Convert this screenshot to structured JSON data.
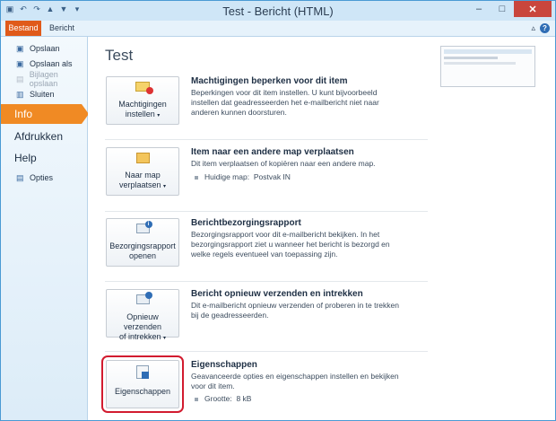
{
  "window": {
    "title": "Test - Bericht (HTML)",
    "qat": {
      "save_icon": "save-icon",
      "undo_icon": "undo-icon",
      "redo_icon": "redo-icon",
      "up_icon": "up-arrow-icon",
      "down_icon": "down-arrow-icon",
      "customize_icon": "chevron-down-icon"
    },
    "controls": {
      "minimize": "–",
      "maximize": "□",
      "close": "✕"
    },
    "help": "?",
    "minimize_ribbon": "▵"
  },
  "ribbon": {
    "file_tab": "Bestand",
    "message_tab": "Bericht"
  },
  "nav": {
    "commands": [
      {
        "label": "Opslaan",
        "icon": "save-icon",
        "glyph": "▣"
      },
      {
        "label": "Opslaan als",
        "icon": "save-as-icon",
        "glyph": "▣"
      },
      {
        "label": "Bijlagen opslaan",
        "icon": "attachment-icon",
        "glyph": "▤"
      },
      {
        "label": "Sluiten",
        "icon": "close-folder-icon",
        "glyph": "▥"
      }
    ],
    "tabs": [
      {
        "label": "Info"
      },
      {
        "label": "Afdrukken"
      },
      {
        "label": "Help"
      }
    ],
    "options": {
      "label": "Opties",
      "icon": "options-icon",
      "glyph": "▤"
    }
  },
  "main": {
    "title": "Test",
    "sections": [
      {
        "button_line1": "Machtigingen",
        "button_line2": "instellen",
        "dropdown": "▾",
        "icon": "permissions-envelope-icon",
        "title": "Machtigingen beperken voor dit item",
        "description": "Beperkingen voor dit item instellen. U kunt bijvoorbeeld instellen dat geadresseerden het e-mailbericht niet naar anderen kunnen doorsturen."
      },
      {
        "button_line1": "Naar map",
        "button_line2": "verplaatsen",
        "dropdown": "▾",
        "icon": "move-folder-icon",
        "title": "Item naar een andere map verplaatsen",
        "description": "Dit item verplaatsen of kopiëren naar een andere map.",
        "property_label": "Huidige map:",
        "property_value": "Postvak IN"
      },
      {
        "button_line1": "Bezorgingsrapport",
        "button_line2": "openen",
        "icon": "delivery-report-icon",
        "title": "Berichtbezorgingsrapport",
        "description": "Bezorgingsrapport voor dit e-mailbericht bekijken. In het bezorgingsrapport ziet u wanneer het bericht is bezorgd en welke regels eventueel van toepassing zijn."
      },
      {
        "button_line1": "Opnieuw verzenden",
        "button_line2": "of intrekken",
        "dropdown": "▾",
        "icon": "resend-icon",
        "title": "Bericht opnieuw verzenden en intrekken",
        "description": "Dit e-mailbericht opnieuw verzenden of proberen in te trekken bij de geadresseerden."
      },
      {
        "button_line1": "Eigenschappen",
        "icon": "properties-icon",
        "title": "Eigenschappen",
        "description": "Geavanceerde opties en eigenschappen instellen en bekijken voor dit item.",
        "property_label": "Grootte:",
        "property_value": "8 kB"
      }
    ]
  }
}
